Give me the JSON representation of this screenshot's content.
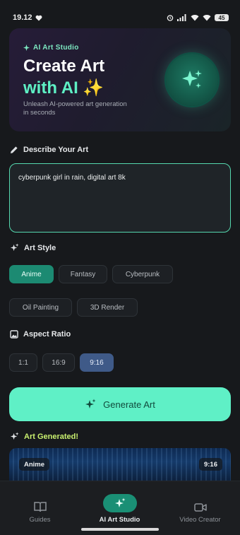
{
  "status_bar": {
    "time": "19.12",
    "battery": "45"
  },
  "hero": {
    "tag": "AI Art Studio",
    "title_line1": "Create Art",
    "title_line2": "with AI ✨",
    "description": "Unleash AI-powered art generation in seconds"
  },
  "describe": {
    "label": "Describe Your Art",
    "value": "cyberpunk girl in rain, digital art 8k"
  },
  "art_style": {
    "label": "Art Style",
    "options": [
      "Anime",
      "Fantasy",
      "Cyberpunk",
      "Oil Painting",
      "3D Render"
    ],
    "selected": "Anime"
  },
  "aspect_ratio": {
    "label": "Aspect Ratio",
    "options": [
      "1:1",
      "16:9",
      "9:16"
    ],
    "selected": "9:16"
  },
  "generate_button": {
    "label": "Generate Art"
  },
  "result": {
    "label": "Art Generated!",
    "style_badge": "Anime",
    "ratio_badge": "9:16"
  },
  "bottom_nav": {
    "items": [
      {
        "label": "Guides",
        "icon": "book-icon"
      },
      {
        "label": "AI Art Studio",
        "icon": "sparkles-icon"
      },
      {
        "label": "Video Creator",
        "icon": "video-camera-icon"
      }
    ],
    "active": "AI Art Studio"
  },
  "colors": {
    "accent": "#5ef0c4",
    "active_chip": "#1c8a72",
    "active_ratio": "#3f5a88",
    "background": "#17191c"
  }
}
